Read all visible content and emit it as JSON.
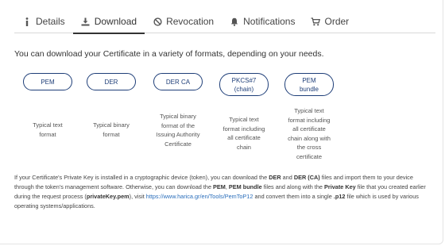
{
  "tabs": [
    {
      "label": "Details",
      "icon": "info-icon"
    },
    {
      "label": "Download",
      "icon": "download-icon",
      "active": true
    },
    {
      "label": "Revocation",
      "icon": "ban-icon"
    },
    {
      "label": "Notifications",
      "icon": "bell-icon"
    },
    {
      "label": "Order",
      "icon": "cart-icon"
    }
  ],
  "intro": "You can download your Certificate in a variety of formats, depending on your needs.",
  "formats": [
    {
      "line1": "PEM",
      "line2": "",
      "desc": [
        "Typical text",
        "format"
      ]
    },
    {
      "line1": "DER",
      "line2": "",
      "desc": [
        "Typical binary",
        "format"
      ]
    },
    {
      "line1": "DER CA",
      "line2": "",
      "desc": [
        "Typical binary",
        "format of the",
        "Issuing Authority",
        "Certificate"
      ]
    },
    {
      "line1": "PKCS#7",
      "line2": "(chain)",
      "desc": [
        "Typical text",
        "format including",
        "all certificate",
        "chain"
      ]
    },
    {
      "line1": "PEM",
      "line2": "bundle",
      "desc": [
        "Typical text",
        "format including",
        "all certificate",
        "chain along with",
        "the cross",
        "certificate"
      ]
    }
  ],
  "footer": {
    "t1": "If your Certificate's Private Key is installed in a cryptographic device (token), you can download the ",
    "b1": "DER",
    "t2": " and ",
    "b2": "DER (CA)",
    "t3": " files and import them to your device through the token's management software. Otherwise, you can download the ",
    "b3": "PEM",
    "t4": ", ",
    "b4": "PEM bundle",
    "t5": " files and along with the ",
    "b5": "Private Key",
    "t6": " file that you created earlier during the request process (",
    "b6": "privateKey.pem",
    "t7": "), visit ",
    "link": "https://www.harica.gr/en/Tools/PemToP12",
    "t8": " and convert them into a single ",
    "b7": ".p12",
    "t9": " file which is used by various operating systems/applications."
  },
  "colors": {
    "accent": "#1e3e78",
    "link": "#2a6ebb",
    "text": "#333333"
  }
}
